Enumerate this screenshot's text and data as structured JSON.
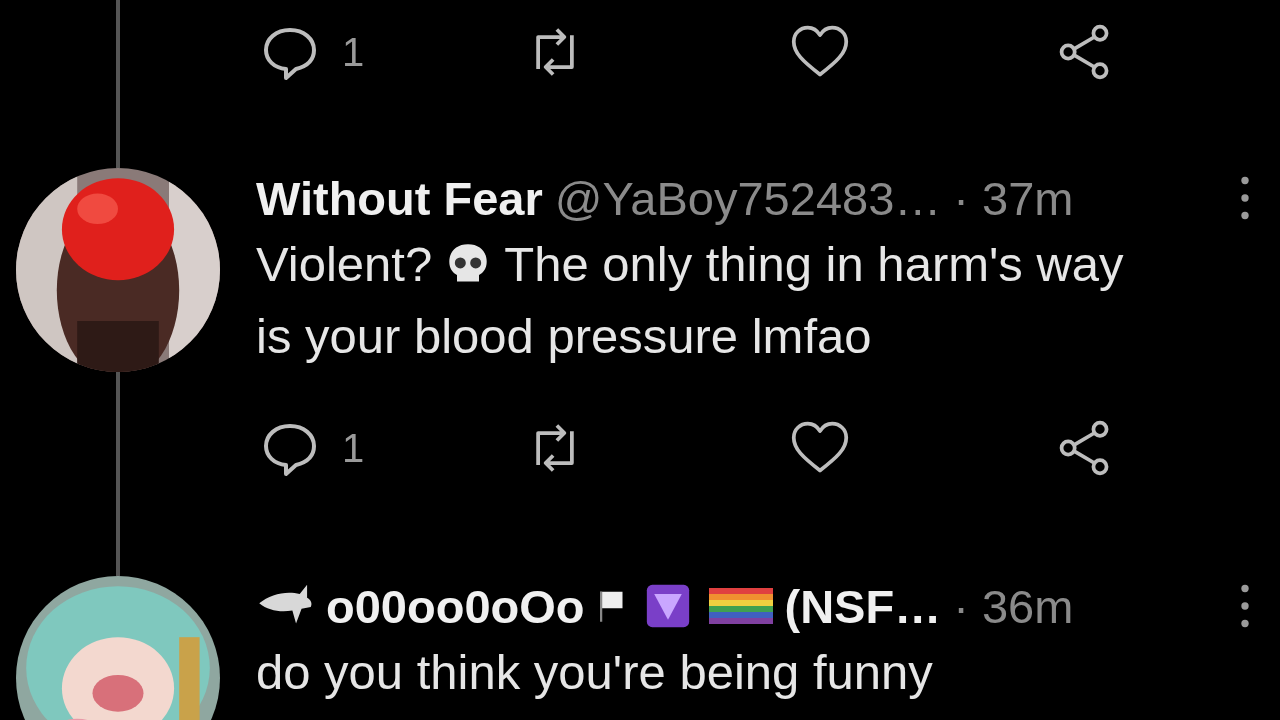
{
  "top_actions": {
    "reply_count": "1"
  },
  "tweets": [
    {
      "avatar": {
        "kind": "picture"
      },
      "name_parts": [
        {
          "kind": "text",
          "text": "Without Fear"
        }
      ],
      "handle": "@YaBoy752483…",
      "time": "· 37m",
      "body_lines": [
        [
          {
            "kind": "text",
            "text": "Violent?"
          },
          {
            "kind": "skull"
          },
          {
            "kind": "text",
            "text": "The only thing in harm's way"
          }
        ],
        [
          {
            "kind": "text",
            "text": "is your blood pressure lmfao"
          }
        ]
      ],
      "actions": {
        "reply_count": "1"
      }
    },
    {
      "avatar": {
        "kind": "picture"
      },
      "name_parts": [
        {
          "kind": "shark"
        },
        {
          "kind": "text",
          "text": "o00oo0oOo"
        },
        {
          "kind": "flag"
        },
        {
          "kind": "gem"
        },
        {
          "kind": "rainbow"
        },
        {
          "kind": "text",
          "text": "(NSF…"
        }
      ],
      "time": "· 36m",
      "body_lines": [
        [
          {
            "kind": "text",
            "text": "do you think you're being funny"
          }
        ]
      ]
    }
  ]
}
